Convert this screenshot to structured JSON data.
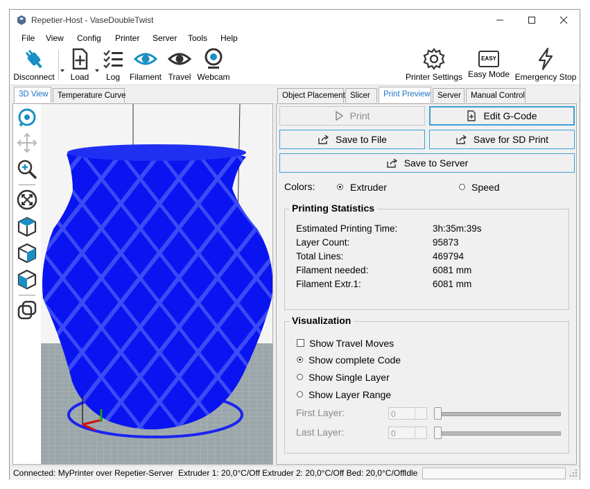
{
  "window": {
    "title": "Repetier-Host - VaseDoubleTwist"
  },
  "menu": [
    "File",
    "View",
    "Config",
    "Printer",
    "Server",
    "Tools",
    "Help"
  ],
  "toolbar": {
    "disconnect": "Disconnect",
    "load": "Load",
    "log": "Log",
    "filament": "Filament",
    "travel": "Travel",
    "webcam": "Webcam",
    "printer_settings": "Printer Settings",
    "easy_mode": "Easy Mode",
    "easy_badge": "EASY",
    "emergency_stop": "Emergency Stop"
  },
  "left_tabs": [
    "3D View",
    "Temperature Curve"
  ],
  "right_tabs": [
    "Object Placement",
    "Slicer",
    "Print Preview",
    "Server",
    "Manual Control"
  ],
  "preview": {
    "print_button": "Print",
    "edit_gcode_button": "Edit G-Code",
    "save_to_file_button": "Save to File",
    "save_sd_button": "Save for SD Print",
    "save_server_button": "Save to Server",
    "colors_label": "Colors:",
    "color_extruder": "Extruder",
    "color_speed": "Speed"
  },
  "stats": {
    "title": "Printing Statistics",
    "rows": [
      {
        "label": "Estimated Printing Time:",
        "value": "3h:35m:39s"
      },
      {
        "label": "Layer Count:",
        "value": "95873"
      },
      {
        "label": "Total Lines:",
        "value": "469794"
      },
      {
        "label": "Filament needed:",
        "value": "6081 mm"
      },
      {
        "label": "Filament Extr.1:",
        "value": "6081 mm"
      }
    ]
  },
  "visualization": {
    "title": "Visualization",
    "show_travel": "Show Travel Moves",
    "show_complete": "Show complete Code",
    "show_single": "Show Single Layer",
    "show_range": "Show Layer Range",
    "first_layer": "First Layer:",
    "last_layer": "Last Layer:",
    "first_value": "0",
    "last_value": "0"
  },
  "status": {
    "connection": "Connected: MyPrinter over Repetier-Server",
    "temps": "Extruder 1: 20,0°C/Off Extruder 2: 20,0°C/Off Bed: 20,0°C/Off",
    "state": "Idle"
  },
  "colors": {
    "accent": "#3c9fd4",
    "model": "#0a14f0",
    "bed": "#9aa6aa",
    "icon_teal": "#1a8fc4"
  }
}
